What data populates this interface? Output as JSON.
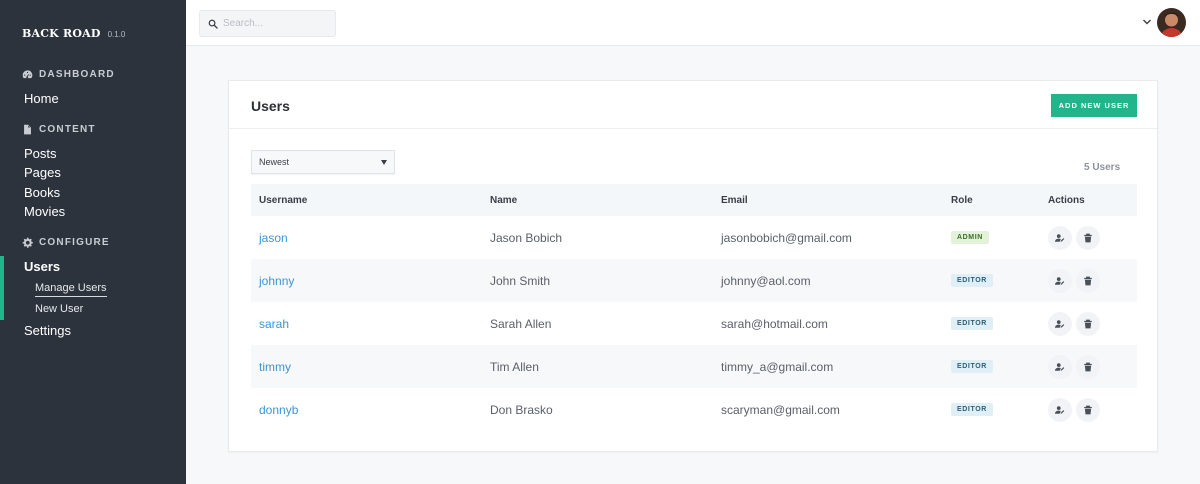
{
  "sidebar": {
    "brand": "BACK ROAD",
    "version": "0.1.0",
    "sections": [
      {
        "icon": "dashboard-icon",
        "label": "DASHBOARD",
        "items": [
          "Home"
        ]
      },
      {
        "icon": "document-icon",
        "label": "CONTENT",
        "items": [
          "Posts",
          "Pages",
          "Books",
          "Movies"
        ]
      },
      {
        "icon": "gear-icon",
        "label": "CONFIGURE",
        "items": [
          "Users",
          "Settings"
        ]
      }
    ],
    "users_subitems": [
      "Manage Users",
      "New User"
    ],
    "active_item": "Users",
    "active_subitem": "Manage Users"
  },
  "topbar": {
    "search_placeholder": "Search..."
  },
  "card": {
    "title": "Users",
    "add_button": "ADD NEW USER",
    "sort_value": "Newest",
    "count_text": "5 Users",
    "columns": [
      "Username",
      "Name",
      "Email",
      "Role",
      "Actions"
    ],
    "rows": [
      {
        "username": "jason",
        "name": "Jason Bobich",
        "email": "jasonbobich@gmail.com",
        "role": "ADMIN"
      },
      {
        "username": "johnny",
        "name": "John Smith",
        "email": "johnny@aol.com",
        "role": "EDITOR"
      },
      {
        "username": "sarah",
        "name": "Sarah Allen",
        "email": "sarah@hotmail.com",
        "role": "EDITOR"
      },
      {
        "username": "timmy",
        "name": "Tim Allen",
        "email": "timmy_a@gmail.com",
        "role": "EDITOR"
      },
      {
        "username": "donnyb",
        "name": "Don Brasko",
        "email": "scaryman@gmail.com",
        "role": "EDITOR"
      }
    ]
  },
  "colors": {
    "sidebar_bg": "#2d333d",
    "accent": "#22b58c",
    "link": "#3d95d4"
  }
}
